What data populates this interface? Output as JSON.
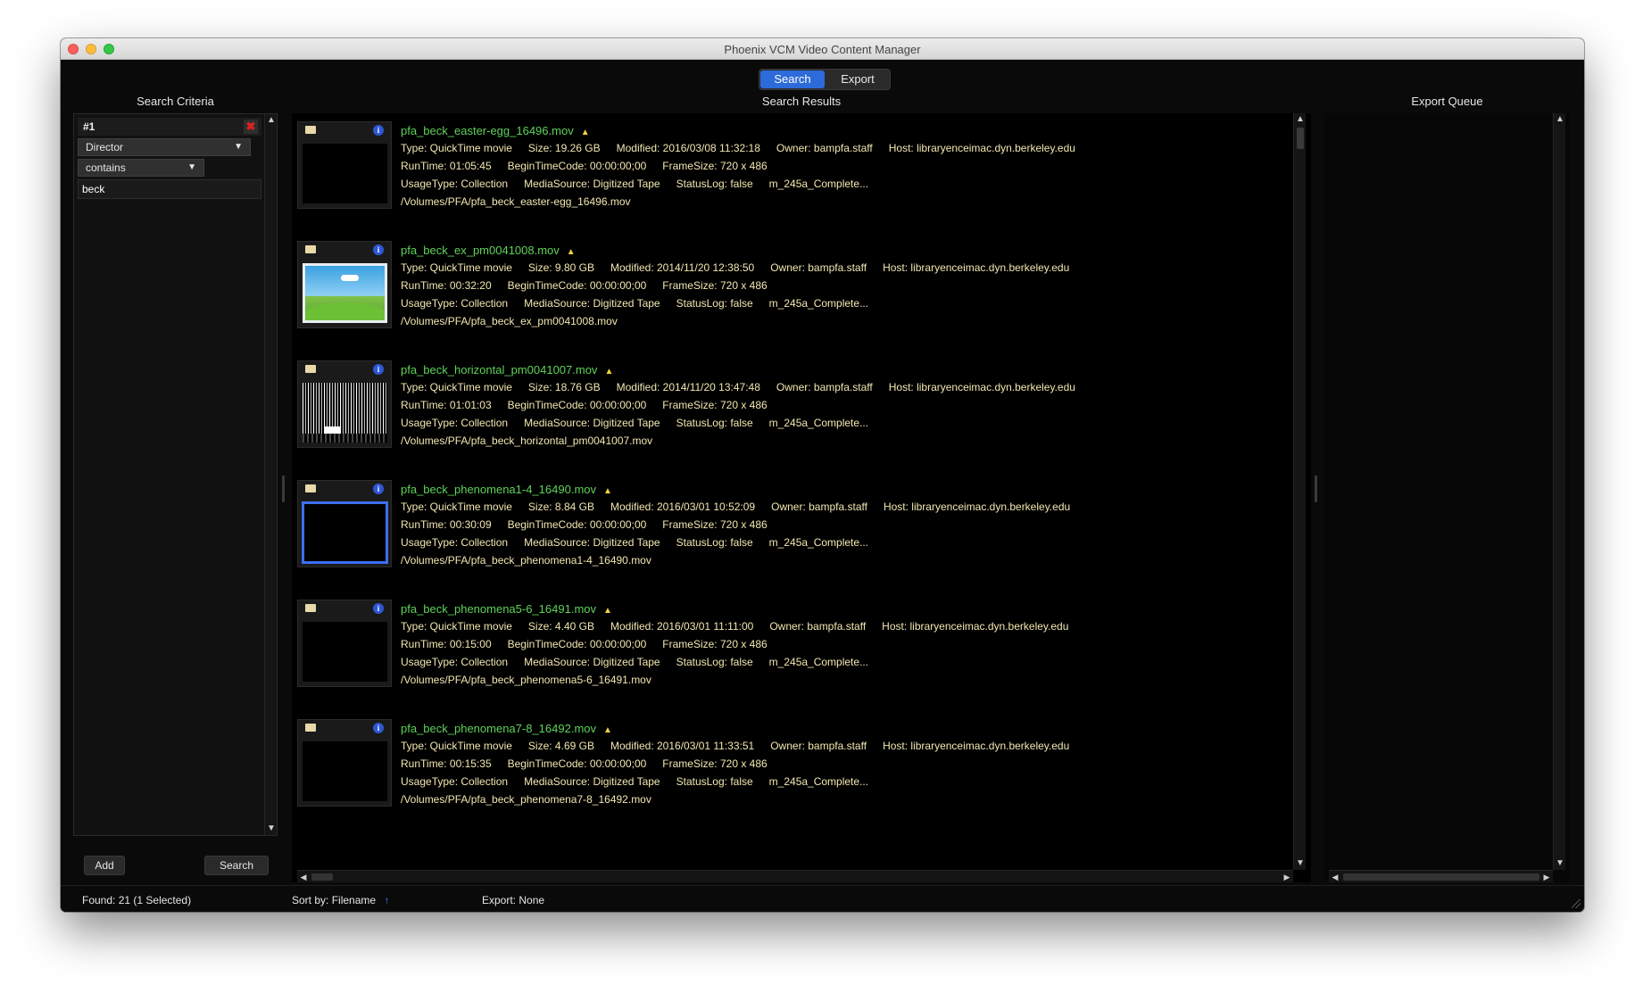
{
  "window": {
    "title": "Phoenix VCM Video Content Manager"
  },
  "mode_tabs": [
    {
      "label": "Search",
      "active": true
    },
    {
      "label": "Export",
      "active": false
    }
  ],
  "sections": {
    "criteria": "Search Criteria",
    "results": "Search Results",
    "export": "Export Queue"
  },
  "criteria": {
    "id": "#1",
    "field": "Director",
    "operator": "contains",
    "value": "beck"
  },
  "buttons": {
    "add": "Add",
    "search": "Search"
  },
  "results": [
    {
      "name": "pfa_beck_easter-egg_16496.mov",
      "type": "Type: QuickTime movie",
      "size": "Size: 19.26 GB",
      "modified": "Modified: 2016/03/08 11:32:18",
      "owner": "Owner: bampfa.staff",
      "host": "Host: libraryenceimac.dyn.berkeley.edu",
      "runtime": "RunTime: 01:05:45",
      "begin_tc": "BeginTimeCode: 00:00:00;00",
      "frame": "FrameSize: 720 x 486",
      "usage": "UsageType: Collection",
      "media": "MediaSource: Digitized Tape",
      "status": "StatusLog: false",
      "log": "m_245a_Complete...",
      "path": "/Volumes/PFA/pfa_beck_easter-egg_16496.mov",
      "thumb": "black"
    },
    {
      "name": "pfa_beck_ex_pm0041008.mov",
      "type": "Type: QuickTime movie",
      "size": "Size: 9.80 GB",
      "modified": "Modified: 2014/11/20 12:38:50",
      "owner": "Owner: bampfa.staff",
      "host": "Host: libraryenceimac.dyn.berkeley.edu",
      "runtime": "RunTime: 00:32:20",
      "begin_tc": "BeginTimeCode: 00:00:00;00",
      "frame": "FrameSize: 720 x 486",
      "usage": "UsageType: Collection",
      "media": "MediaSource: Digitized Tape",
      "status": "StatusLog: false",
      "log": "m_245a_Complete...",
      "path": "/Volumes/PFA/pfa_beck_ex_pm0041008.mov",
      "thumb": "landscape"
    },
    {
      "name": "pfa_beck_horizontal_pm0041007.mov",
      "type": "Type: QuickTime movie",
      "size": "Size: 18.76 GB",
      "modified": "Modified: 2014/11/20 13:47:48",
      "owner": "Owner: bampfa.staff",
      "host": "Host: libraryenceimac.dyn.berkeley.edu",
      "runtime": "RunTime: 01:01:03",
      "begin_tc": "BeginTimeCode: 00:00:00;00",
      "frame": "FrameSize: 720 x 486",
      "usage": "UsageType: Collection",
      "media": "MediaSource: Digitized Tape",
      "status": "StatusLog: false",
      "log": "m_245a_Complete...",
      "path": "/Volumes/PFA/pfa_beck_horizontal_pm0041007.mov",
      "thumb": "noise"
    },
    {
      "name": "pfa_beck_phenomena1-4_16490.mov",
      "type": "Type: QuickTime movie",
      "size": "Size: 8.84 GB",
      "modified": "Modified: 2016/03/01 10:52:09",
      "owner": "Owner: bampfa.staff",
      "host": "Host: libraryenceimac.dyn.berkeley.edu",
      "runtime": "RunTime: 00:30:09",
      "begin_tc": "BeginTimeCode: 00:00:00;00",
      "frame": "FrameSize: 720 x 486",
      "usage": "UsageType: Collection",
      "media": "MediaSource: Digitized Tape",
      "status": "StatusLog: false",
      "log": "m_245a_Complete...",
      "path": "/Volumes/PFA/pfa_beck_phenomena1-4_16490.mov",
      "thumb": "selected"
    },
    {
      "name": "pfa_beck_phenomena5-6_16491.mov",
      "type": "Type: QuickTime movie",
      "size": "Size: 4.40 GB",
      "modified": "Modified: 2016/03/01 11:11:00",
      "owner": "Owner: bampfa.staff",
      "host": "Host: libraryenceimac.dyn.berkeley.edu",
      "runtime": "RunTime: 00:15:00",
      "begin_tc": "BeginTimeCode: 00:00:00;00",
      "frame": "FrameSize: 720 x 486",
      "usage": "UsageType: Collection",
      "media": "MediaSource: Digitized Tape",
      "status": "StatusLog: false",
      "log": "m_245a_Complete...",
      "path": "/Volumes/PFA/pfa_beck_phenomena5-6_16491.mov",
      "thumb": "black"
    },
    {
      "name": "pfa_beck_phenomena7-8_16492.mov",
      "type": "Type: QuickTime movie",
      "size": "Size: 4.69 GB",
      "modified": "Modified: 2016/03/01 11:33:51",
      "owner": "Owner: bampfa.staff",
      "host": "Host: libraryenceimac.dyn.berkeley.edu",
      "runtime": "RunTime: 00:15:35",
      "begin_tc": "BeginTimeCode: 00:00:00;00",
      "frame": "FrameSize: 720 x 486",
      "usage": "UsageType: Collection",
      "media": "MediaSource: Digitized Tape",
      "status": "StatusLog: false",
      "log": "m_245a_Complete...",
      "path": "/Volumes/PFA/pfa_beck_phenomena7-8_16492.mov",
      "thumb": "black"
    }
  ],
  "status": {
    "found_label": "Found:",
    "found_count": "21",
    "selected": "(1 Selected)",
    "sort_label": "Sort by:",
    "sort_value": "Filename",
    "export_label": "Export:",
    "export_value": "None"
  },
  "colors": {
    "accent": "#2c6bd9",
    "filename": "#5fd25a",
    "metadata": "#f1e6b0",
    "selection": "#3b6ff2"
  }
}
